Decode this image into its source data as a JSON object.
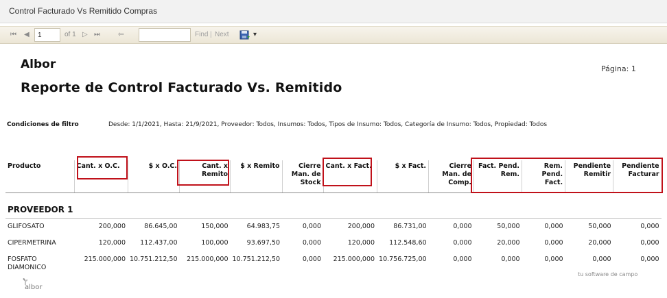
{
  "window": {
    "title": "Control Facturado Vs Remitido Compras"
  },
  "toolbar": {
    "first_icon": "⏮",
    "prev_icon": "◀",
    "page_value": "1",
    "of_label": "of 1",
    "next_icon": "▷",
    "last_icon": "⏭",
    "back_icon": "⇦",
    "find_value": "",
    "find_label": "Find",
    "separator": "|",
    "next_label": "Next",
    "export_icon": "save-icon",
    "export_caret": "▾"
  },
  "report": {
    "company": "Albor",
    "title": "Reporte de Control Facturado Vs. Remitido",
    "page_label": "Página: 1",
    "filter_label": "Condiciones de filtro",
    "filter_text": "Desde: 1/1/2021, Hasta: 21/9/2021, Proveedor: Todos, Insumos: Todos, Tipos de Insumo: Todos, Categoría de Insumo: Todos, Propiedad: Todos",
    "columns": [
      "Producto",
      "Cant. x O.C.",
      "$ x O.C.",
      "Cant. x Remito",
      "$ x Remito",
      "Cierre Man. de Stock",
      "Cant. x Fact.",
      "$ x Fact.",
      "Cierre Man. de Comp.",
      "Fact. Pend. Rem.",
      "Rem. Pend. Fact.",
      "Pendiente Remitir",
      "Pendiente Facturar"
    ],
    "group": "PROVEEDOR 1",
    "rows": [
      [
        "GLIFOSATO",
        "200,000",
        "86.645,00",
        "150,000",
        "64.983,75",
        "0,000",
        "200,000",
        "86.731,00",
        "0,000",
        "50,000",
        "0,000",
        "50,000",
        "0,000"
      ],
      [
        "CIPERMETRINA",
        "120,000",
        "112.437,00",
        "100,000",
        "93.697,50",
        "0,000",
        "120,000",
        "112.548,60",
        "0,000",
        "20,000",
        "0,000",
        "20,000",
        "0,000"
      ],
      [
        "FOSFATO DIAMONICO",
        "215.000,000",
        "10.751.212,50",
        "215.000,000",
        "10.751.212,50",
        "0,000",
        "215.000,000",
        "10.756.725,00",
        "0,000",
        "0,000",
        "0,000",
        "0,000",
        "0,000"
      ]
    ],
    "footer_logo": "albor",
    "tagline": "tu software de campo"
  },
  "colors": {
    "highlight": "#c0111a",
    "toolbar": "#efe9da"
  }
}
